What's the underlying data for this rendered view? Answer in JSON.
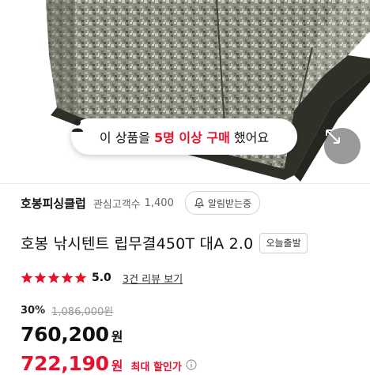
{
  "banner": {
    "prefix": "이 상품을 ",
    "highlight": "5명 이상 구매",
    "suffix": " 했어요"
  },
  "store": {
    "name": "호봉피싱클럽",
    "follower_label": "관심고객수",
    "follower_count": "1,400",
    "alert_label": "알림받는중"
  },
  "product": {
    "title": "호봉 낚시텐트 립무결450T 대A 2.0",
    "badge": "오늘출발",
    "rating": "5.0",
    "stars": 5,
    "review_link": "3건 리뷰 보기"
  },
  "price": {
    "discount_rate": "30%",
    "original": "1,086,000원",
    "current": "760,200",
    "unit": "원",
    "max_discount": "722,190",
    "max_label": "최대 할인가"
  },
  "colors": {
    "accent_red": "#e8112d",
    "star": "#e8112d",
    "camo_base": "#8d8e80"
  },
  "icons": {
    "banner": "person-icon",
    "expand": "expand-arrows-icon",
    "alert": "bell-icon",
    "info": "info-icon"
  }
}
